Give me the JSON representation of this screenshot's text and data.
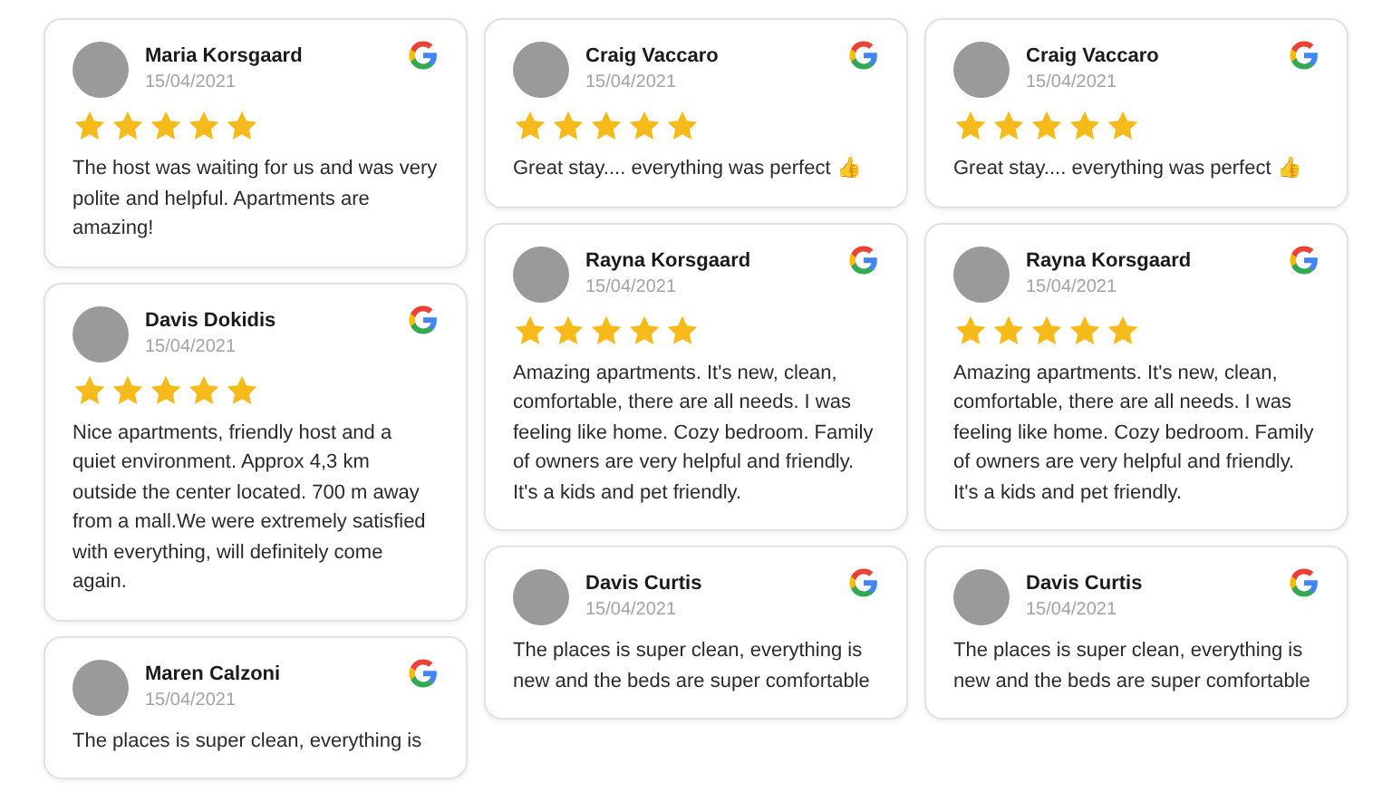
{
  "columns": [
    {
      "reviews": [
        {
          "name": "Maria Korsgaard",
          "date": "15/04/2021",
          "stars": 5,
          "text": "The host was waiting for us and was very polite and helpful. Apartments are amazing!"
        },
        {
          "name": "Davis Dokidis",
          "date": "15/04/2021",
          "stars": 5,
          "text": "Nice apartments, friendly host and a quiet environment. Approx 4,3 km outside the center located. 700 m away from a mall.We were extremely satisfied with everything, will definitely come again."
        },
        {
          "name": "Maren Calzoni",
          "date": "15/04/2021",
          "text": "The places is super clean, everything is"
        }
      ]
    },
    {
      "reviews": [
        {
          "name": "Craig Vaccaro",
          "date": "15/04/2021",
          "stars": 5,
          "text": "Great stay.... everything was perfect 👍"
        },
        {
          "name": "Rayna Korsgaard",
          "date": "15/04/2021",
          "stars": 5,
          "text": "Amazing apartments. It's new, clean, comfortable, there are all needs. I was feeling like home. Cozy bedroom. Family of owners are very helpful and friendly. It's a kids and pet friendly."
        },
        {
          "name": "Davis Curtis",
          "date": "15/04/2021",
          "text": "The places is super clean, everything is new and the beds are super comfortable"
        }
      ]
    },
    {
      "reviews": [
        {
          "name": "Craig Vaccaro",
          "date": "15/04/2021",
          "stars": 5,
          "text": "Great stay.... everything was perfect 👍"
        },
        {
          "name": "Rayna Korsgaard",
          "date": "15/04/2021",
          "stars": 5,
          "text": "Amazing apartments. It's new, clean, comfortable, there are all needs. I was feeling like home. Cozy bedroom. Family of owners are very helpful and friendly. It's a kids and pet friendly."
        },
        {
          "name": "Davis Curtis",
          "date": "15/04/2021",
          "text": "The places is super clean, everything is new and the beds are super comfortable"
        }
      ]
    }
  ]
}
